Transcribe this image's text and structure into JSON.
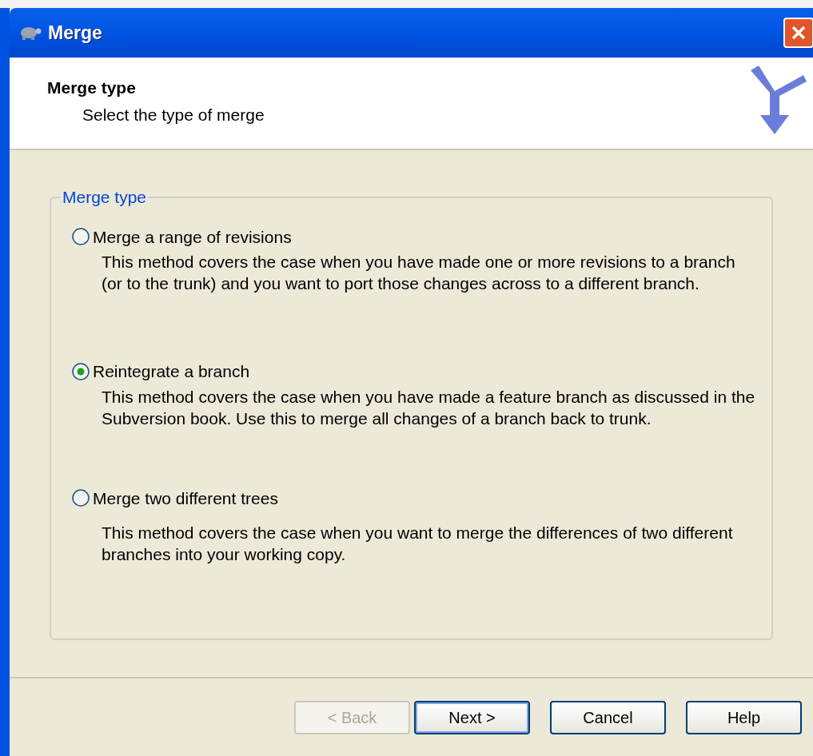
{
  "window": {
    "title": "Merge"
  },
  "header": {
    "title": "Merge type",
    "subtitle": "Select the type of merge"
  },
  "group": {
    "label": "Merge type",
    "options": [
      {
        "label": "Merge a range of revisions",
        "description": "This method covers the case when you have made one or more revisions to a branch (or to the trunk) and you want to port those changes across to a different branch.",
        "selected": false
      },
      {
        "label": "Reintegrate a branch",
        "description": "This method covers the case when you have made a feature branch as discussed in the Subversion book. Use this to merge all changes of a branch back to trunk.",
        "selected": true
      },
      {
        "label": "Merge two different trees",
        "description": "This method covers the case when you want to merge the differences of two different branches into your working copy.",
        "selected": false
      }
    ]
  },
  "buttons": [
    {
      "label": "< Back",
      "disabled": true,
      "default": false
    },
    {
      "label": "Next >",
      "disabled": false,
      "default": true
    },
    {
      "label": "Cancel",
      "disabled": false,
      "default": false
    },
    {
      "label": "Help",
      "disabled": false,
      "default": false
    }
  ]
}
